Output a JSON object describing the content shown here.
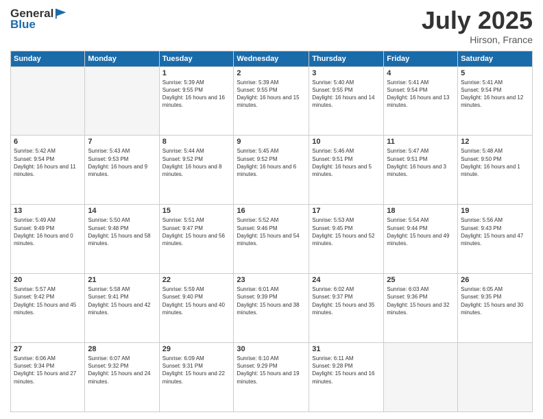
{
  "header": {
    "logo_general": "General",
    "logo_blue": "Blue",
    "month": "July 2025",
    "location": "Hirson, France"
  },
  "days_of_week": [
    "Sunday",
    "Monday",
    "Tuesday",
    "Wednesday",
    "Thursday",
    "Friday",
    "Saturday"
  ],
  "weeks": [
    [
      {
        "day": "",
        "sunrise": "",
        "sunset": "",
        "daylight": ""
      },
      {
        "day": "",
        "sunrise": "",
        "sunset": "",
        "daylight": ""
      },
      {
        "day": "1",
        "sunrise": "Sunrise: 5:39 AM",
        "sunset": "Sunset: 9:55 PM",
        "daylight": "Daylight: 16 hours and 16 minutes."
      },
      {
        "day": "2",
        "sunrise": "Sunrise: 5:39 AM",
        "sunset": "Sunset: 9:55 PM",
        "daylight": "Daylight: 16 hours and 15 minutes."
      },
      {
        "day": "3",
        "sunrise": "Sunrise: 5:40 AM",
        "sunset": "Sunset: 9:55 PM",
        "daylight": "Daylight: 16 hours and 14 minutes."
      },
      {
        "day": "4",
        "sunrise": "Sunrise: 5:41 AM",
        "sunset": "Sunset: 9:54 PM",
        "daylight": "Daylight: 16 hours and 13 minutes."
      },
      {
        "day": "5",
        "sunrise": "Sunrise: 5:41 AM",
        "sunset": "Sunset: 9:54 PM",
        "daylight": "Daylight: 16 hours and 12 minutes."
      }
    ],
    [
      {
        "day": "6",
        "sunrise": "Sunrise: 5:42 AM",
        "sunset": "Sunset: 9:54 PM",
        "daylight": "Daylight: 16 hours and 11 minutes."
      },
      {
        "day": "7",
        "sunrise": "Sunrise: 5:43 AM",
        "sunset": "Sunset: 9:53 PM",
        "daylight": "Daylight: 16 hours and 9 minutes."
      },
      {
        "day": "8",
        "sunrise": "Sunrise: 5:44 AM",
        "sunset": "Sunset: 9:52 PM",
        "daylight": "Daylight: 16 hours and 8 minutes."
      },
      {
        "day": "9",
        "sunrise": "Sunrise: 5:45 AM",
        "sunset": "Sunset: 9:52 PM",
        "daylight": "Daylight: 16 hours and 6 minutes."
      },
      {
        "day": "10",
        "sunrise": "Sunrise: 5:46 AM",
        "sunset": "Sunset: 9:51 PM",
        "daylight": "Daylight: 16 hours and 5 minutes."
      },
      {
        "day": "11",
        "sunrise": "Sunrise: 5:47 AM",
        "sunset": "Sunset: 9:51 PM",
        "daylight": "Daylight: 16 hours and 3 minutes."
      },
      {
        "day": "12",
        "sunrise": "Sunrise: 5:48 AM",
        "sunset": "Sunset: 9:50 PM",
        "daylight": "Daylight: 16 hours and 1 minute."
      }
    ],
    [
      {
        "day": "13",
        "sunrise": "Sunrise: 5:49 AM",
        "sunset": "Sunset: 9:49 PM",
        "daylight": "Daylight: 16 hours and 0 minutes."
      },
      {
        "day": "14",
        "sunrise": "Sunrise: 5:50 AM",
        "sunset": "Sunset: 9:48 PM",
        "daylight": "Daylight: 15 hours and 58 minutes."
      },
      {
        "day": "15",
        "sunrise": "Sunrise: 5:51 AM",
        "sunset": "Sunset: 9:47 PM",
        "daylight": "Daylight: 15 hours and 56 minutes."
      },
      {
        "day": "16",
        "sunrise": "Sunrise: 5:52 AM",
        "sunset": "Sunset: 9:46 PM",
        "daylight": "Daylight: 15 hours and 54 minutes."
      },
      {
        "day": "17",
        "sunrise": "Sunrise: 5:53 AM",
        "sunset": "Sunset: 9:45 PM",
        "daylight": "Daylight: 15 hours and 52 minutes."
      },
      {
        "day": "18",
        "sunrise": "Sunrise: 5:54 AM",
        "sunset": "Sunset: 9:44 PM",
        "daylight": "Daylight: 15 hours and 49 minutes."
      },
      {
        "day": "19",
        "sunrise": "Sunrise: 5:56 AM",
        "sunset": "Sunset: 9:43 PM",
        "daylight": "Daylight: 15 hours and 47 minutes."
      }
    ],
    [
      {
        "day": "20",
        "sunrise": "Sunrise: 5:57 AM",
        "sunset": "Sunset: 9:42 PM",
        "daylight": "Daylight: 15 hours and 45 minutes."
      },
      {
        "day": "21",
        "sunrise": "Sunrise: 5:58 AM",
        "sunset": "Sunset: 9:41 PM",
        "daylight": "Daylight: 15 hours and 42 minutes."
      },
      {
        "day": "22",
        "sunrise": "Sunrise: 5:59 AM",
        "sunset": "Sunset: 9:40 PM",
        "daylight": "Daylight: 15 hours and 40 minutes."
      },
      {
        "day": "23",
        "sunrise": "Sunrise: 6:01 AM",
        "sunset": "Sunset: 9:39 PM",
        "daylight": "Daylight: 15 hours and 38 minutes."
      },
      {
        "day": "24",
        "sunrise": "Sunrise: 6:02 AM",
        "sunset": "Sunset: 9:37 PM",
        "daylight": "Daylight: 15 hours and 35 minutes."
      },
      {
        "day": "25",
        "sunrise": "Sunrise: 6:03 AM",
        "sunset": "Sunset: 9:36 PM",
        "daylight": "Daylight: 15 hours and 32 minutes."
      },
      {
        "day": "26",
        "sunrise": "Sunrise: 6:05 AM",
        "sunset": "Sunset: 9:35 PM",
        "daylight": "Daylight: 15 hours and 30 minutes."
      }
    ],
    [
      {
        "day": "27",
        "sunrise": "Sunrise: 6:06 AM",
        "sunset": "Sunset: 9:34 PM",
        "daylight": "Daylight: 15 hours and 27 minutes."
      },
      {
        "day": "28",
        "sunrise": "Sunrise: 6:07 AM",
        "sunset": "Sunset: 9:32 PM",
        "daylight": "Daylight: 15 hours and 24 minutes."
      },
      {
        "day": "29",
        "sunrise": "Sunrise: 6:09 AM",
        "sunset": "Sunset: 9:31 PM",
        "daylight": "Daylight: 15 hours and 22 minutes."
      },
      {
        "day": "30",
        "sunrise": "Sunrise: 6:10 AM",
        "sunset": "Sunset: 9:29 PM",
        "daylight": "Daylight: 15 hours and 19 minutes."
      },
      {
        "day": "31",
        "sunrise": "Sunrise: 6:11 AM",
        "sunset": "Sunset: 9:28 PM",
        "daylight": "Daylight: 15 hours and 16 minutes."
      },
      {
        "day": "",
        "sunrise": "",
        "sunset": "",
        "daylight": ""
      },
      {
        "day": "",
        "sunrise": "",
        "sunset": "",
        "daylight": ""
      }
    ]
  ]
}
